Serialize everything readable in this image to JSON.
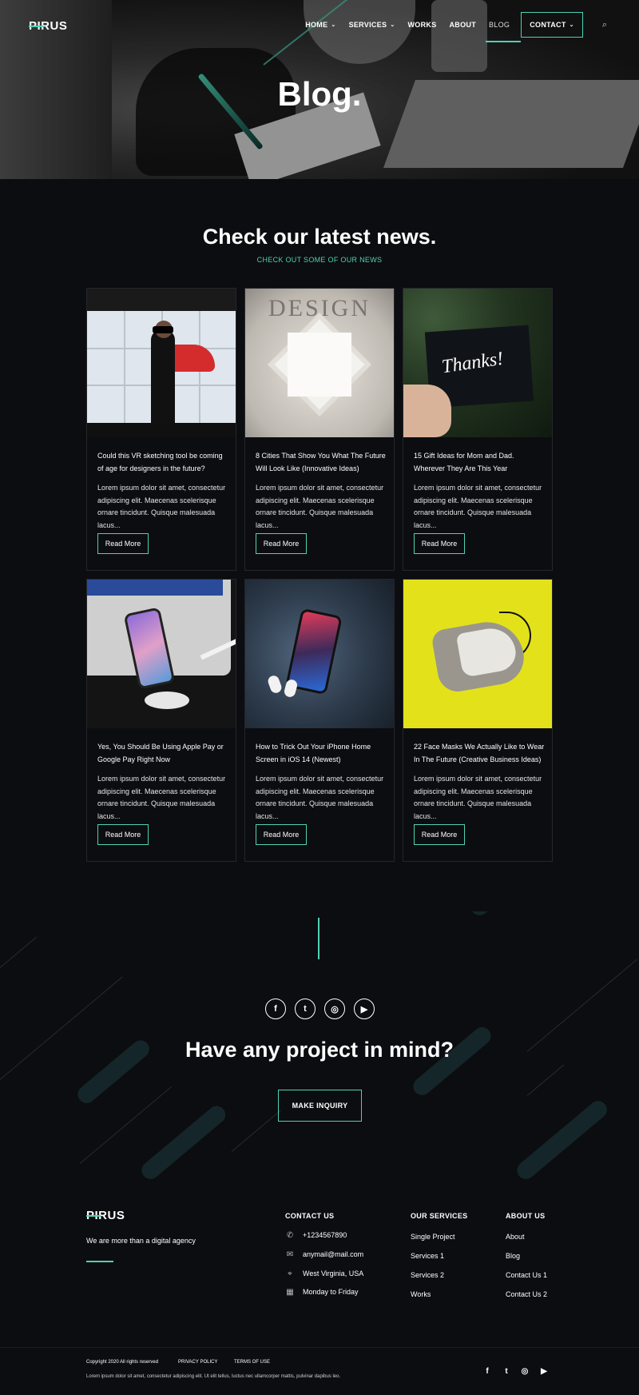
{
  "brand": {
    "logo": "PIRUS"
  },
  "nav": {
    "home": "HOME",
    "services": "SERVICES",
    "works": "WORKS",
    "about": "ABOUT",
    "blog": "BLOG",
    "contact": "CONTACT",
    "chevron": "⌄",
    "search_glyph": "⌕"
  },
  "hero": {
    "title": "Blog."
  },
  "news": {
    "title": "Check our latest news.",
    "subtitle": "CHECK OUT SOME OF OUR NEWS",
    "read_more": "Read More",
    "excerpt": "Lorem ipsum dolor sit amet, consectetur adipiscing elit. Maecenas scelerisque ornare tincidunt. Quisque malesuada lacus...",
    "posts": [
      {
        "title": "Could this VR sketching tool be coming of age for designers in the future?",
        "image": "vr-sketching-photo"
      },
      {
        "title": "8 Cities That Show You What The Future Will Look Like (Innovative Ideas)",
        "image": "design-book-cover-photo",
        "image_text": "DESIGN"
      },
      {
        "title": "15 Gift Ideas for Mom and Dad. Wherever They Are This Year",
        "image": "thanks-card-photo",
        "image_text": "Thanks!"
      },
      {
        "title": "Yes, You Should Be Using Apple Pay or Google Pay Right Now",
        "image": "phone-on-stand-photo"
      },
      {
        "title": "How to Trick Out Your iPhone Home Screen in iOS 14 (Newest)",
        "image": "iphone-airpods-photo"
      },
      {
        "title": "22 Face Masks We Actually Like to Wear In The Future (Creative Business Ideas)",
        "image": "face-mask-photo"
      }
    ]
  },
  "cta": {
    "title": "Have any project in mind?",
    "button": "MAKE INQUIRY",
    "social": {
      "facebook": "f",
      "twitter": "t",
      "instagram": "◎",
      "youtube": "▶"
    }
  },
  "footer": {
    "tagline": "We are more than a digital agency",
    "contact": {
      "heading": "CONTACT US",
      "phone": "+1234567890",
      "email": "anymail@mail.com",
      "location": "West Virginia, USA",
      "hours": "Monday to Friday"
    },
    "services": {
      "heading": "OUR SERVICES",
      "links": [
        "Single Project",
        "Services 1",
        "Services 2",
        "Works"
      ]
    },
    "about": {
      "heading": "ABOUT US",
      "links": [
        "About",
        "Blog",
        "Contact Us 1",
        "Contact Us 2"
      ]
    },
    "copyright": "Copyright 2020 All rights reserved",
    "privacy": "PRIVACY POLICY",
    "terms": "TERMS OF USE",
    "bottom_text": "Lorem ipsum dolor sit amet, consectetur adipiscing elit. Ut elit tellus, luctus nec ullamcorper mattis, pulvinar dapibus leo."
  },
  "colors": {
    "accent": "#4fd1b5",
    "background": "#0c0d10",
    "card_border": "#24262b",
    "stripe": "#142629"
  },
  "icons": [
    "search-icon",
    "chevron-down-icon",
    "facebook-icon",
    "twitter-icon",
    "instagram-icon",
    "youtube-icon",
    "phone-icon",
    "mail-icon",
    "location-pin-icon",
    "calendar-icon"
  ]
}
